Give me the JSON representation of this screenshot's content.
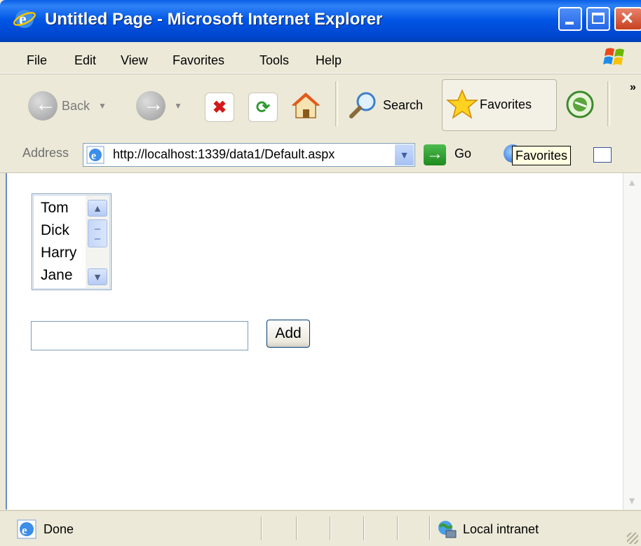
{
  "window": {
    "title": "Untitled Page - Microsoft Internet Explorer"
  },
  "menu": {
    "items": [
      "File",
      "Edit",
      "View",
      "Favorites",
      "Tools",
      "Help"
    ]
  },
  "toolbar": {
    "back_label": "Back",
    "search_label": "Search",
    "favorites_label": "Favorites"
  },
  "address": {
    "label": "Address",
    "url": "http://localhost:1339/data1/Default.aspx",
    "go_label": "Go",
    "tooltip": "Favorites"
  },
  "page": {
    "listbox": {
      "items": [
        "Tom",
        "Dick",
        "Harry",
        "Jane"
      ]
    },
    "textbox": {
      "value": ""
    },
    "add_button": "Add"
  },
  "status": {
    "text": "Done",
    "zone": "Local intranet"
  },
  "colors": {
    "title_bar": "#0055e5",
    "content_bg": "#ffffff",
    "chrome_bg": "#ece9d8"
  },
  "icons": [
    "ie-icon",
    "windows-flag-icon",
    "back-icon",
    "forward-icon",
    "stop-icon",
    "refresh-icon",
    "home-icon",
    "search-icon",
    "favorites-star-icon",
    "media-icon",
    "go-arrow-icon",
    "links-globe-icon",
    "local-intranet-icon"
  ]
}
